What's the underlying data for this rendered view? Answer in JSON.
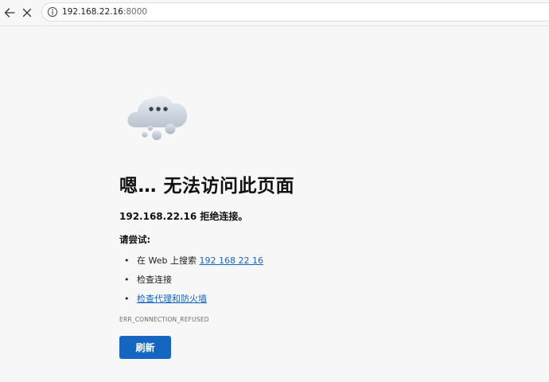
{
  "toolbar": {
    "back_icon": "back-arrow-icon",
    "close_icon": "close-icon",
    "info_icon": "info-icon",
    "url_host": "192.168.22.16",
    "url_port": ":8000"
  },
  "error": {
    "illustration": "cloud-icon",
    "title": "嗯… 无法访问此页面",
    "message": "192.168.22.16 拒绝连接。",
    "try_label": "请尝试:",
    "suggestions": [
      {
        "prefix": "在 Web 上搜索 ",
        "link": "192 168 22 16"
      },
      {
        "text": "检查连接"
      },
      {
        "link": "检查代理和防火墙"
      }
    ],
    "code": "ERR_CONNECTION_REFUSED",
    "refresh_label": "刷新",
    "accent_color": "#1566c0"
  }
}
